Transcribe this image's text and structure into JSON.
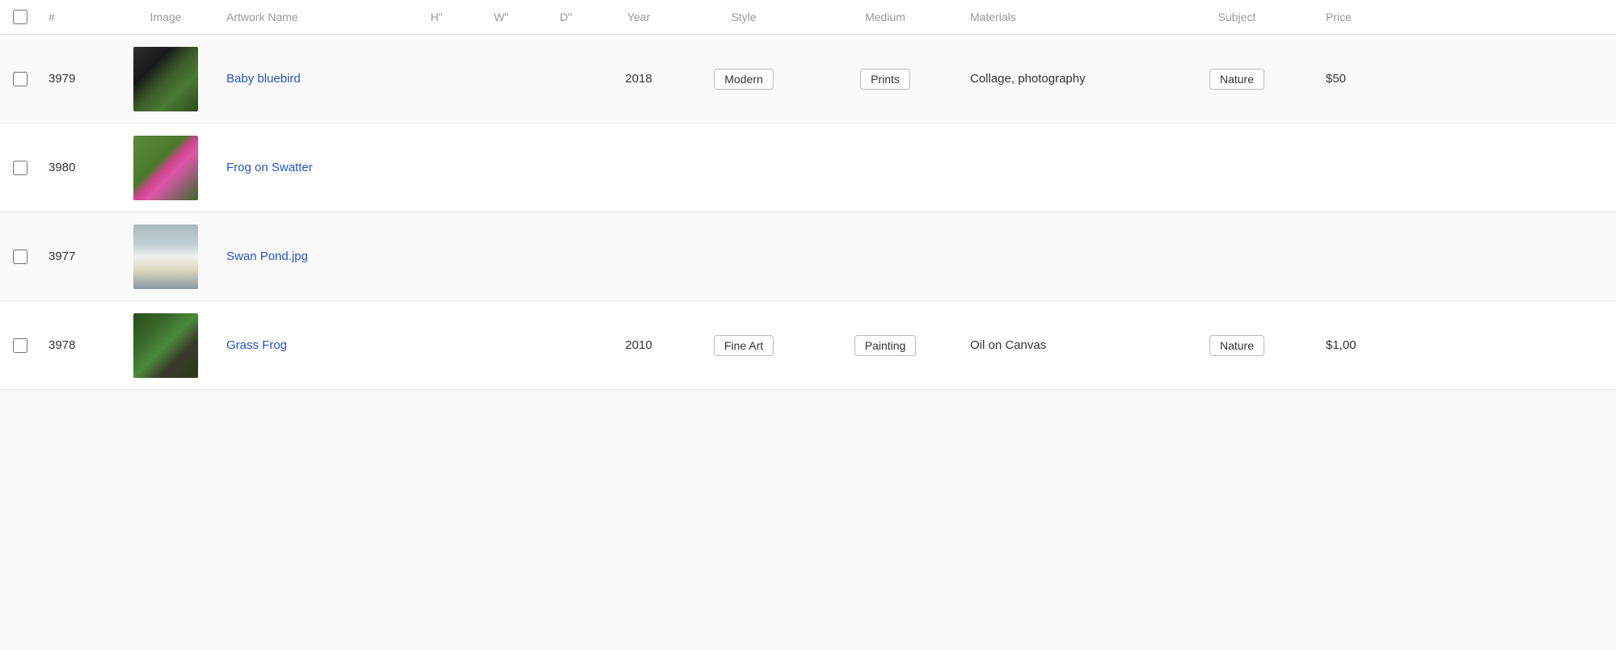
{
  "table": {
    "columns": [
      {
        "key": "check",
        "label": ""
      },
      {
        "key": "num",
        "label": "#"
      },
      {
        "key": "image",
        "label": "Image"
      },
      {
        "key": "name",
        "label": "Artwork Name"
      },
      {
        "key": "h",
        "label": "H\""
      },
      {
        "key": "w",
        "label": "W\""
      },
      {
        "key": "d",
        "label": "D\""
      },
      {
        "key": "year",
        "label": "Year"
      },
      {
        "key": "style",
        "label": "Style"
      },
      {
        "key": "medium",
        "label": "Medium"
      },
      {
        "key": "materials",
        "label": "Materials"
      },
      {
        "key": "subject",
        "label": "Subject"
      },
      {
        "key": "price",
        "label": "Price"
      }
    ],
    "rows": [
      {
        "id": 3979,
        "name": "Baby bluebird",
        "image_class": "img-baby-bluebird",
        "h": "",
        "w": "",
        "d": "",
        "year": "2018",
        "style": "Modern",
        "medium": "Prints",
        "materials": "Collage, photography",
        "subject": "Nature",
        "price": "$50"
      },
      {
        "id": 3980,
        "name": "Frog on Swatter",
        "image_class": "img-frog-swatter",
        "h": "",
        "w": "",
        "d": "",
        "year": "",
        "style": "",
        "medium": "",
        "materials": "",
        "subject": "",
        "price": ""
      },
      {
        "id": 3977,
        "name": "Swan Pond.jpg",
        "image_class": "img-swan-pond",
        "h": "",
        "w": "",
        "d": "",
        "year": "",
        "style": "",
        "medium": "",
        "materials": "",
        "subject": "",
        "price": ""
      },
      {
        "id": 3978,
        "name": "Grass Frog",
        "image_class": "img-grass-frog",
        "h": "",
        "w": "",
        "d": "",
        "year": "2010",
        "style": "Fine Art",
        "medium": "Painting",
        "materials": "Oil on Canvas",
        "subject": "Nature",
        "price": "$1,00"
      }
    ]
  }
}
